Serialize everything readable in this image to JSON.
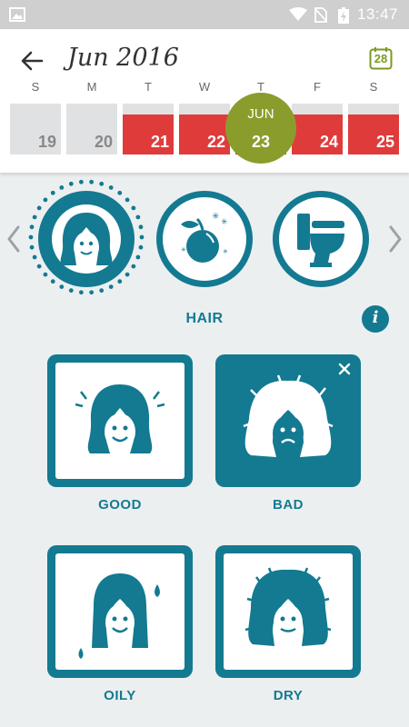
{
  "status_bar": {
    "time": "13:47"
  },
  "header": {
    "month_title": "Jun 2016",
    "calendar_today": "28"
  },
  "calendar": {
    "weekdays": [
      "S",
      "M",
      "T",
      "W",
      "T",
      "F",
      "S"
    ],
    "days": [
      {
        "num": "19",
        "type": "normal"
      },
      {
        "num": "20",
        "type": "normal"
      },
      {
        "num": "21",
        "type": "period"
      },
      {
        "num": "22",
        "type": "period"
      },
      {
        "num": "23",
        "type": "today"
      },
      {
        "num": "24",
        "type": "period"
      },
      {
        "num": "25",
        "type": "period"
      }
    ],
    "today_month": "JUN",
    "today_day": "23"
  },
  "categories": {
    "items": [
      "hair-icon",
      "fruit-icon",
      "toilet-icon"
    ],
    "selected_label": "HAIR"
  },
  "options": [
    {
      "label": "GOOD",
      "selected": false
    },
    {
      "label": "BAD",
      "selected": true
    },
    {
      "label": "OILY",
      "selected": false
    },
    {
      "label": "DRY",
      "selected": false
    }
  ],
  "colors": {
    "teal": "#137a91",
    "period_red": "#e03b3b",
    "today_green": "#8a9d2c"
  }
}
